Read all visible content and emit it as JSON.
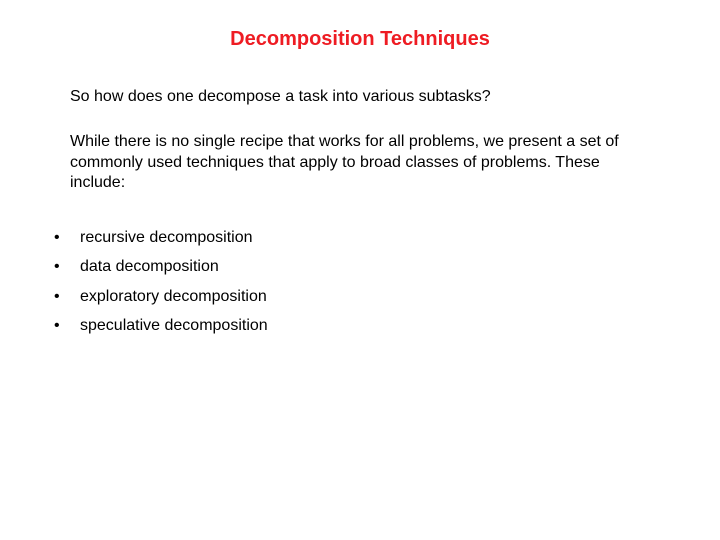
{
  "title": "Decomposition Techniques",
  "intro": {
    "p1": "So how does one decompose a task into various subtasks?",
    "p2": "While there is no single recipe that works for all problems, we present a set of commonly used techniques that apply to broad classes of problems. These include:"
  },
  "bullets": [
    "recursive decomposition",
    "data decomposition",
    "exploratory decomposition",
    "speculative decomposition"
  ]
}
